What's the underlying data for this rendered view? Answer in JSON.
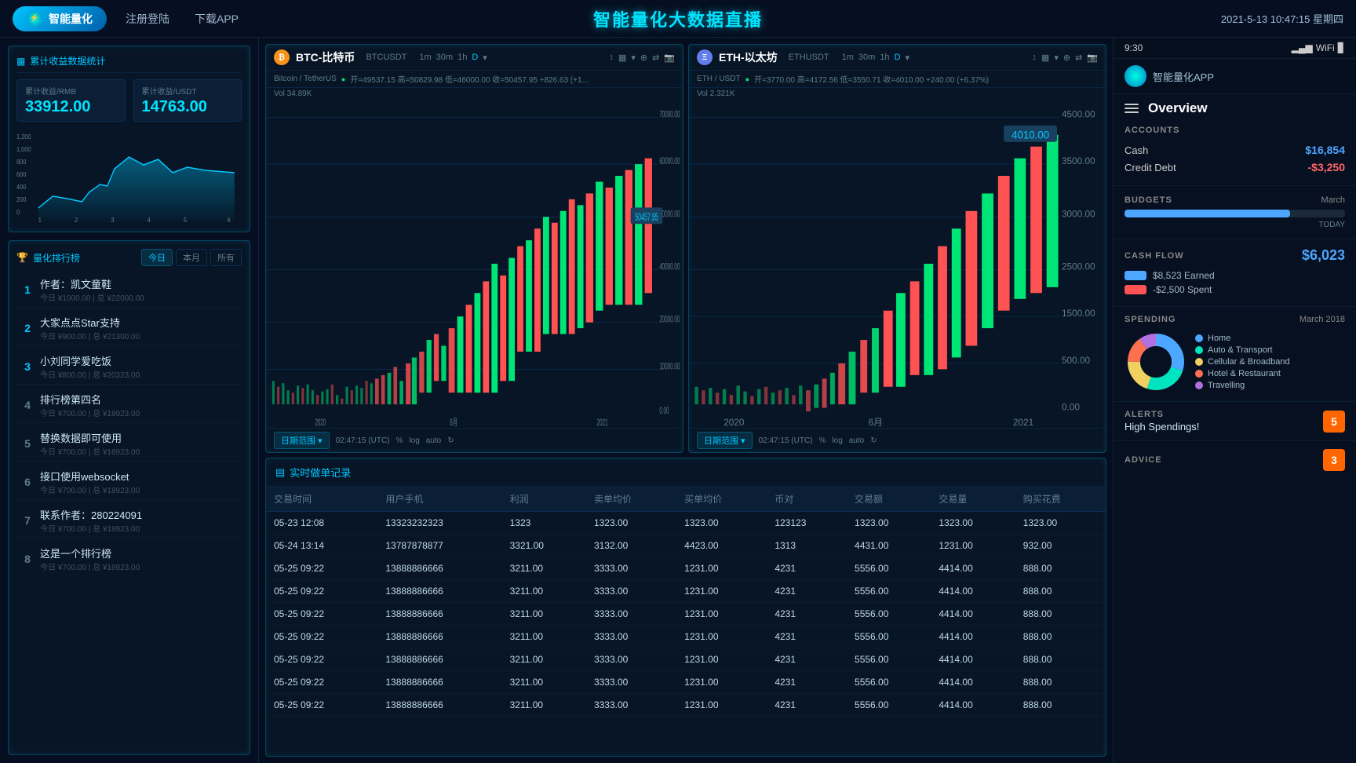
{
  "nav": {
    "logo_label": "智能量化",
    "link1": "注册登陆",
    "link2": "下载APP",
    "center_title": "智能量化大数据直播",
    "datetime": "2021-5-13  10:47:15  星期四"
  },
  "left": {
    "stats_title": "累计收益数据统计",
    "stat1_label": "累计收益/RMB",
    "stat1_value": "33912.00",
    "stat2_label": "累计收益/USDT",
    "stat2_value": "14763.00",
    "rank_title": "量化排行榜",
    "tab_today": "今日",
    "tab_month": "本月",
    "tab_all": "所有",
    "rank_items": [
      {
        "num": "1",
        "name": "作者：凯文童鞋",
        "sub": "今日 ¥1000.00 | 总 ¥22000.00"
      },
      {
        "num": "2",
        "name": "大家点点Star支持",
        "sub": "今日 ¥900.00 | 总 ¥21300.00"
      },
      {
        "num": "3",
        "name": "小刘同学爱吃饭",
        "sub": "今日 ¥800.00 | 总 ¥20323.00"
      },
      {
        "num": "4",
        "name": "排行榜第四名",
        "sub": "今日 ¥700.00 | 总 ¥18923.00"
      },
      {
        "num": "5",
        "name": "替换数据即可使用",
        "sub": "今日 ¥700.00 | 总 ¥18923.00"
      },
      {
        "num": "6",
        "name": "接口使用websocket",
        "sub": "今日 ¥700.00 | 总 ¥18923.00"
      },
      {
        "num": "7",
        "name": "联系作者：280224091",
        "sub": "今日 ¥700.00 | 总 ¥18923.00"
      },
      {
        "num": "8",
        "name": "这是一个排行榜",
        "sub": "今日 ¥700.00 | 总 ¥18923.00"
      }
    ]
  },
  "btc_chart": {
    "pair": "BTCUSDT",
    "coin_label": "BTC-比特币",
    "tf_options": [
      "1m",
      "30m",
      "1h",
      "D"
    ],
    "pair_label": "Bitcoin / TetherUS",
    "price_info": "开=49537.15 高=50829.98 低=46000.00 收=50457.95 +826.63 (+1...",
    "vol": "Vol 34.89K",
    "current_price": "50457.95",
    "date_range": "日期范围 ▾",
    "utc_time": "02:47:15 (UTC)",
    "log_label": "log",
    "auto_label": "auto"
  },
  "eth_chart": {
    "pair": "ETHUSDT",
    "coin_label": "ETH-以太坊",
    "tf_options": [
      "1m",
      "30m",
      "1h",
      "D"
    ],
    "pair_label": "ETH / USDT",
    "price_info": "开=3770.00 高=4172.56 低=3550.71 收=4010.00 +240.00 (+6.37%)",
    "vol": "Vol 2.321K",
    "current_price": "4010.00",
    "date_range": "日期范围 ▾",
    "utc_time": "02:47:15 (UTC)",
    "log_label": "log",
    "auto_label": "auto"
  },
  "table": {
    "title": "实时做单记录",
    "columns": [
      "交易时间",
      "用户手机",
      "利润",
      "卖单均价",
      "买单均价",
      "币对",
      "交易额",
      "交易量",
      "购买花费"
    ],
    "rows": [
      [
        "05-23 12:08",
        "13323232323",
        "1323",
        "1323.00",
        "1323.00",
        "123123",
        "1323.00",
        "1323.00",
        "1323.00"
      ],
      [
        "05-24 13:14",
        "13787878877",
        "3321.00",
        "3132.00",
        "4423.00",
        "1313",
        "4431.00",
        "1231.00",
        "932.00"
      ],
      [
        "05-25 09:22",
        "13888886666",
        "3211.00",
        "3333.00",
        "1231.00",
        "4231",
        "5556.00",
        "4414.00",
        "888.00"
      ],
      [
        "05-25 09:22",
        "13888886666",
        "3211.00",
        "3333.00",
        "1231.00",
        "4231",
        "5556.00",
        "4414.00",
        "888.00"
      ],
      [
        "05-25 09:22",
        "13888886666",
        "3211.00",
        "3333.00",
        "1231.00",
        "4231",
        "5556.00",
        "4414.00",
        "888.00"
      ],
      [
        "05-25 09:22",
        "13888886666",
        "3211.00",
        "3333.00",
        "1231.00",
        "4231",
        "5556.00",
        "4414.00",
        "888.00"
      ],
      [
        "05-25 09:22",
        "13888886666",
        "3211.00",
        "3333.00",
        "1231.00",
        "4231",
        "5556.00",
        "4414.00",
        "888.00"
      ],
      [
        "05-25 09:22",
        "13888886666",
        "3211.00",
        "3333.00",
        "1231.00",
        "4231",
        "5556.00",
        "4414.00",
        "888.00"
      ],
      [
        "05-25 09:22",
        "13888886666",
        "3211.00",
        "3333.00",
        "1231.00",
        "4231",
        "5556.00",
        "4414.00",
        "888.00"
      ]
    ]
  },
  "phone": {
    "time": "9:30",
    "app_name": "智能量化APP",
    "overview_title": "Overview",
    "accounts_title": "ACCOUNTS",
    "cash_label": "Cash",
    "cash_value": "$16,854",
    "credit_label": "Credit Debt",
    "credit_value": "-$3,250",
    "budgets_title": "BUDGETS",
    "budgets_month": "March",
    "budget_today": "TODAY",
    "budget_pct": 75,
    "cashflow_title": "CASH FLOW",
    "cashflow_earned": "$8,523 Earned",
    "cashflow_spent": "-$2,500 Spent",
    "cashflow_total": "$6,023",
    "spending_title": "SPENDING",
    "spending_period": "March 2018",
    "spending_categories": [
      {
        "label": "Home",
        "color": "#4da6ff"
      },
      {
        "label": "Auto & Transport",
        "color": "#00e5c0"
      },
      {
        "label": "Cellular & Broadband",
        "color": "#f0d060"
      },
      {
        "label": "Hotel & Restaurant",
        "color": "#ff7050"
      },
      {
        "label": "Travelling",
        "color": "#b070e0"
      }
    ],
    "alerts_title": "ALERTS",
    "alerts_text": "High Spendings!",
    "alerts_count": "5",
    "advice_title": "ADVICE",
    "advice_count": "3"
  },
  "icons": {
    "bar_chart": "▦",
    "trophy": "🏆",
    "list": "≡",
    "btc": "₿",
    "eth": "Ξ",
    "table_icon": "▤",
    "signal": "▂▄▆",
    "wifi": "WiFi",
    "battery": "🔋"
  }
}
